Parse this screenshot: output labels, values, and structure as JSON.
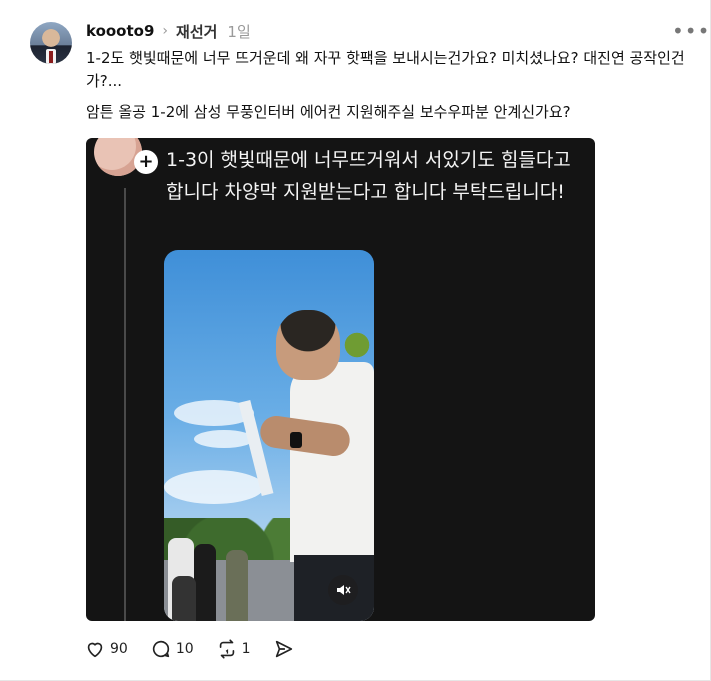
{
  "post": {
    "username": "koooto9",
    "topic": "재선거",
    "time": "1일",
    "more_icon": "more-horizontal-icon",
    "text_line1": "1-2도 햇빛때문에 너무 뜨거운데 왜 자꾸 핫팩을 보내시는건가요? 미치셨나요? 대진연 공작인건가?...",
    "text_line2": "암튼 올공 1-2에 삼성 무풍인터버 에어컨 지원해주실 보수우파분 안계신가요?"
  },
  "embedded": {
    "caption": "1-3이 햇빛때문에 너무뜨거워서 서있기도 힘들다고합니다 차양막 지원받는다고 합니다 부탁드립니다!",
    "plus_icon": "plus-icon",
    "mute_icon": "muted-speaker-icon"
  },
  "actions": {
    "likes": "90",
    "replies": "10",
    "reposts": "1",
    "like_icon": "heart-icon",
    "reply_icon": "comment-bubble-icon",
    "repost_icon": "repost-icon",
    "share_icon": "send-icon"
  }
}
